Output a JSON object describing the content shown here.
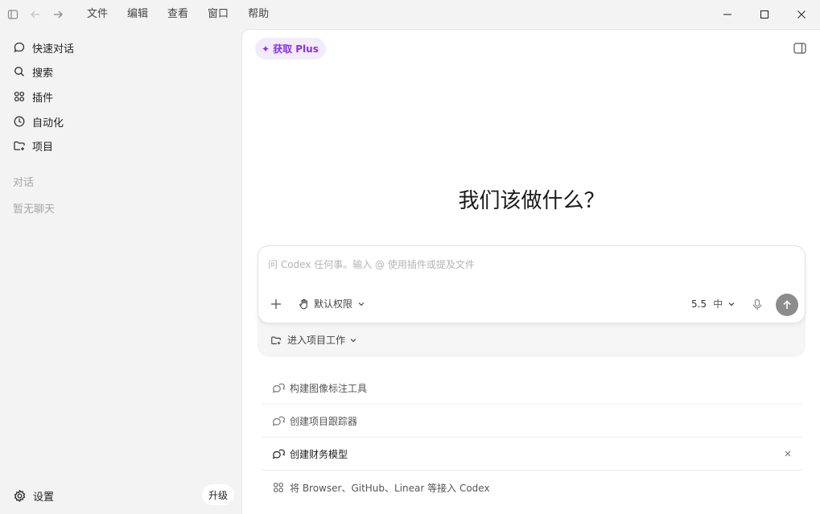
{
  "menu": [
    "文件",
    "编辑",
    "查看",
    "窗口",
    "帮助"
  ],
  "sidebar": {
    "items": [
      {
        "label": "快速对话",
        "icon": "chat-bubble-icon"
      },
      {
        "label": "搜索",
        "icon": "search-icon"
      },
      {
        "label": "插件",
        "icon": "plugins-grid-icon"
      },
      {
        "label": "自动化",
        "icon": "clock-icon"
      },
      {
        "label": "项目",
        "icon": "folder-plus-icon"
      }
    ],
    "section_title": "对话",
    "empty_text": "暂无聊天",
    "settings_label": "设置",
    "upgrade_label": "升级"
  },
  "main": {
    "plus_badge": "获取 Plus",
    "headline": "我们该做什么？",
    "composer": {
      "placeholder": "问 Codex 任何事。输入 @ 使用插件或提及文件",
      "permission_label": "默认权限",
      "model": "5.5",
      "reasoning": "中"
    },
    "project_label": "进入项目工作",
    "suggestions": [
      {
        "label": "构建图像标注工具",
        "icon": "chat-spark-icon"
      },
      {
        "label": "创建项目跟踪器",
        "icon": "chat-spark-icon"
      },
      {
        "label": "创建财务模型",
        "icon": "chat-spark-icon",
        "active": true
      },
      {
        "label": "将 Browser、GitHub、Linear 等接入 Codex",
        "icon": "plugins-grid-icon"
      }
    ]
  },
  "colors": {
    "sidebar_bg": "#f3f3f3",
    "main_bg": "#ffffff",
    "plus_accent": "#8a35d6",
    "plus_bg": "#f3ebfc",
    "send_button": "#8c8c8c"
  }
}
